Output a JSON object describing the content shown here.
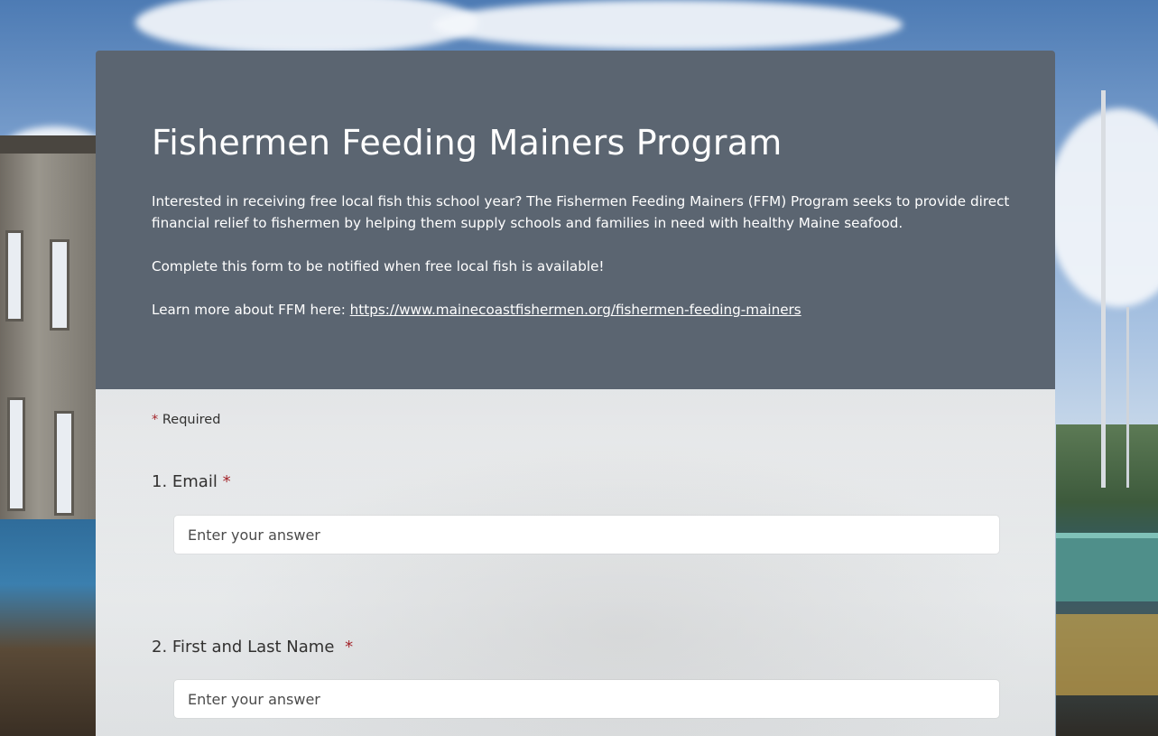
{
  "form": {
    "title": "Fishermen Feeding Mainers Program",
    "description_1": "Interested in receiving free local fish this school year? The Fishermen Feeding Mainers (FFM) Program seeks to provide direct financial relief to fishermen by helping them supply schools and families in need with healthy Maine seafood.",
    "description_2": "Complete this form to be notified when free local fish is available!",
    "learn_more_prefix": "Learn more about FFM here: ",
    "learn_more_link": "https://www.mainecoastfishermen.org/fishermen-feeding-mainers"
  },
  "required_note": {
    "star": "*",
    "label": "Required"
  },
  "questions": [
    {
      "label": "1. Email",
      "star": "*",
      "value": "",
      "placeholder": "Enter your answer"
    },
    {
      "label": "2. First and Last Name",
      "star": "*",
      "value": "",
      "placeholder": "Enter your answer"
    }
  ],
  "colors": {
    "header_bg": "#5b6571",
    "required_star": "#a4262c",
    "text": "#323130"
  }
}
